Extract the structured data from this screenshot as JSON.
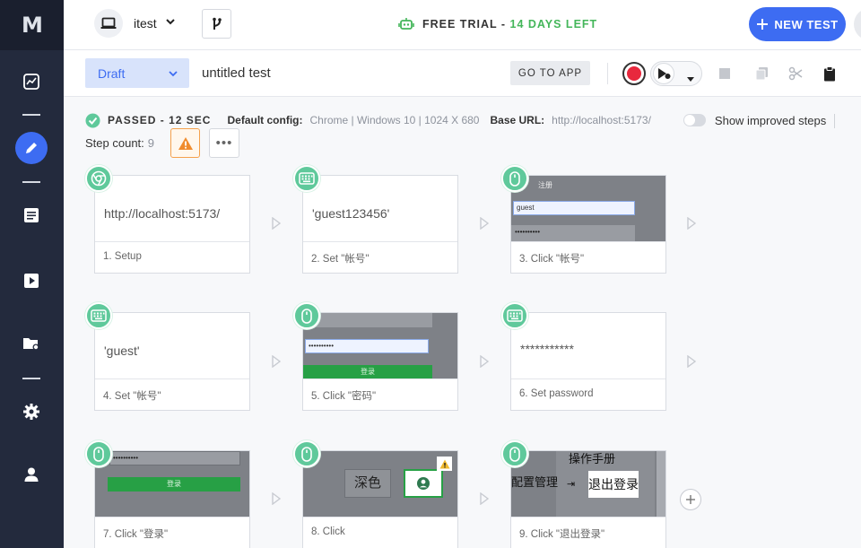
{
  "app": {
    "logo": "M"
  },
  "sidebar": {
    "items": [
      {
        "name": "insights-icon"
      },
      {
        "name": "edit-icon",
        "active": true
      },
      {
        "name": "list-icon"
      },
      {
        "name": "play-icon"
      },
      {
        "name": "folder-settings-icon"
      },
      {
        "name": "gear-icon"
      },
      {
        "name": "user-icon"
      }
    ]
  },
  "topbar": {
    "env_name": "itest",
    "trial_label": "FREE TRIAL - ",
    "trial_days": "14 DAYS LEFT",
    "new_test_label": "NEW TEST",
    "accent": "#3d6cf2",
    "trial_green": "#44b65a"
  },
  "toolbar": {
    "status": "Draft",
    "test_name": "untitled test",
    "goto_label": "GO TO APP"
  },
  "info": {
    "passed": "PASSED - 12 SEC",
    "config_label": "Default config:",
    "config_value": "Chrome | Windows 10 | 1024 X 680",
    "base_url_label": "Base URL:",
    "base_url_value": "http://localhost:5173/",
    "improved_label": "Show improved steps",
    "step_count_label": "Step count:",
    "step_count": "9"
  },
  "steps": [
    {
      "icon": "chrome-icon",
      "preview_text": "http://localhost:5173/",
      "label": "1. Setup"
    },
    {
      "icon": "keyboard-icon",
      "preview_text": "'guest123456'",
      "label": "2. Set \"帐号\""
    },
    {
      "icon": "mouse-icon",
      "shot_text_1": "注册",
      "shot_input": "guest",
      "shot_dots": "••••••••••",
      "label": "3. Click \"帐号\""
    },
    {
      "icon": "keyboard-icon",
      "preview_text": "'guest'",
      "label": "4. Set \"帐号\""
    },
    {
      "icon": "mouse-icon",
      "shot_input": "••••••••••",
      "shot_button": "登录",
      "label": "5. Click \"密码\""
    },
    {
      "icon": "keyboard-icon",
      "preview_text": "***********",
      "label": "6. Set password"
    },
    {
      "icon": "mouse-icon",
      "shot_dots": "••••••••••",
      "shot_button": "登录",
      "label": "7. Click \"登录\""
    },
    {
      "icon": "mouse-icon",
      "shot_text_1": "深色",
      "label": "8. Click"
    },
    {
      "icon": "mouse-icon",
      "shot_text_1": "操作手册",
      "shot_text_2": "配置管理",
      "shot_text_3": "退出登录",
      "label": "9. Click \"退出登录\""
    }
  ]
}
